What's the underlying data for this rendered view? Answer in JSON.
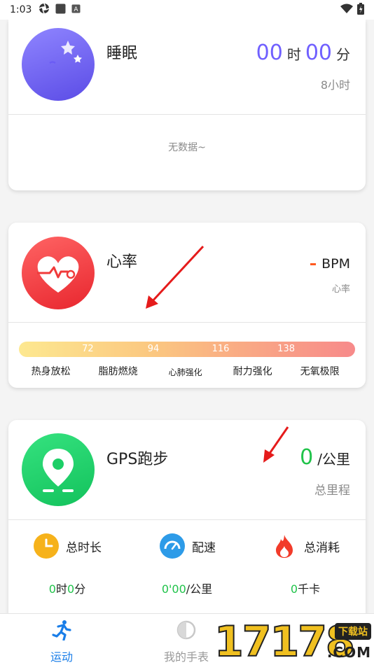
{
  "status_bar": {
    "time": "1:03",
    "left_icons": [
      "aperture-icon",
      "square-icon",
      "a-box-icon"
    ],
    "right_icons": [
      "wifi-icon",
      "battery-icon"
    ]
  },
  "sleep": {
    "title": "睡眠",
    "hours": "00",
    "hour_unit": "时",
    "minutes": "00",
    "minute_unit": "分",
    "goal": "8小时",
    "empty_text": "无数据~",
    "icon": "moon-stars-icon",
    "color": "#6b5cf5"
  },
  "heart_rate": {
    "title": "心率",
    "value_placeholder": "-",
    "unit": "BPM",
    "label": "心率",
    "icon": "heart-pulse-icon",
    "color": "#f03a3a",
    "thresholds": [
      "72",
      "94",
      "116",
      "138"
    ],
    "zones": [
      "热身放松",
      "脂肪燃烧",
      "心肺强化",
      "耐力强化",
      "无氧极限"
    ]
  },
  "gps_run": {
    "title": "GPS跑步",
    "distance": "0",
    "distance_unit": "/公里",
    "distance_label": "总里程",
    "icon": "location-pin-icon",
    "color": "#20c34a",
    "stats": [
      {
        "label": "总时长",
        "icon": "clock-icon",
        "value_parts": [
          "0",
          "时",
          "0",
          "分"
        ]
      },
      {
        "label": "配速",
        "icon": "speedometer-icon",
        "value_parts": [
          "0'00",
          "/公里"
        ]
      },
      {
        "label": "总消耗",
        "icon": "flame-icon",
        "value_parts": [
          "0",
          "千卡"
        ]
      }
    ]
  },
  "bottom_nav": {
    "items": [
      {
        "label": "运动",
        "icon": "running-icon",
        "active": true
      },
      {
        "label": "我的手表",
        "icon": "watch-icon",
        "active": false
      }
    ]
  },
  "watermark": {
    "number": "17178",
    "tag": "下载站",
    "domain": ".COM"
  }
}
